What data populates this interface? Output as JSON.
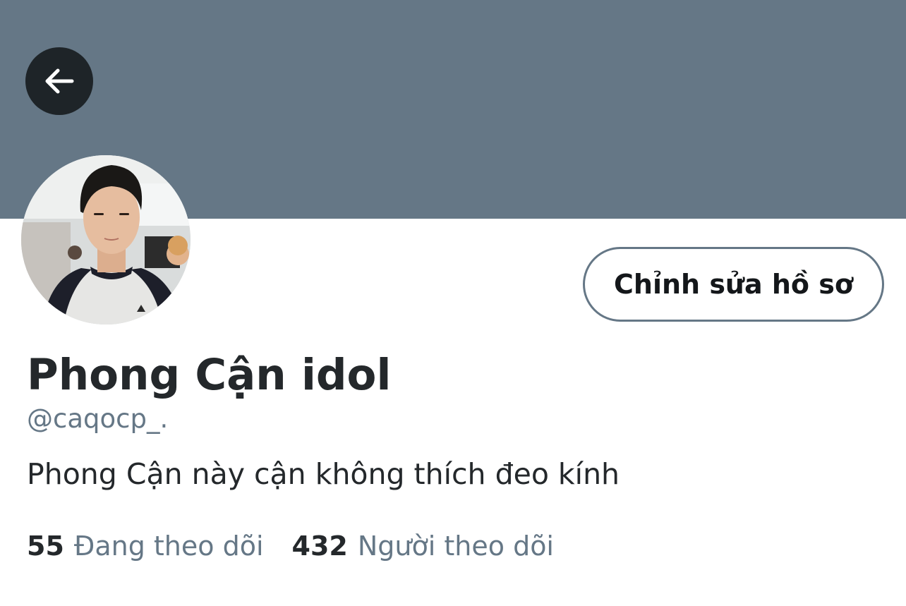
{
  "header": {
    "banner_color": "#657786",
    "back_icon": "arrow-left-icon"
  },
  "profile": {
    "avatar": "profile-photo",
    "edit_button_label": "Chỉnh sửa hồ sơ",
    "display_name": "Phong Cận idol",
    "handle": "@caqocp_.",
    "bio": "Phong Cận này cận không thích đeo kính"
  },
  "stats": {
    "following_count": "55",
    "following_label": "Đang theo dõi",
    "followers_count": "432",
    "followers_label": "Người theo dõi"
  },
  "colors": {
    "text_primary": "#24282b",
    "text_secondary": "#657786",
    "button_border": "#657786"
  }
}
